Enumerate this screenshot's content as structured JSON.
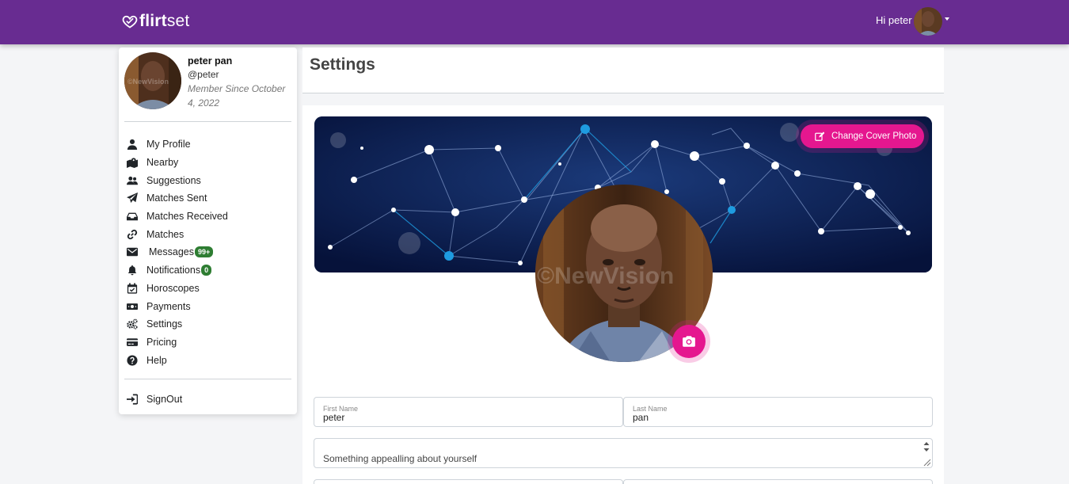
{
  "brand": {
    "name_bold": "flirt",
    "name_light": "set"
  },
  "nav": {
    "greeting": "Hi peter"
  },
  "profile": {
    "name": "peter pan",
    "handle": "@peter",
    "member_since": "Member Since October 4, 2022"
  },
  "menu": [
    {
      "label": "My Profile",
      "icon": "user-icon"
    },
    {
      "label": "Nearby",
      "icon": "map-marker-icon"
    },
    {
      "label": "Suggestions",
      "icon": "users-icon"
    },
    {
      "label": "Matches Sent",
      "icon": "paper-plane-icon"
    },
    {
      "label": "Matches Received",
      "icon": "inbox-icon"
    },
    {
      "label": "Matches",
      "icon": "link-icon"
    },
    {
      "label": "Messages",
      "icon": "envelope-icon",
      "badge": "99+"
    },
    {
      "label": "Notifications",
      "icon": "bell-icon",
      "badge": "0"
    },
    {
      "label": "Horoscopes",
      "icon": "calendar-check-icon"
    },
    {
      "label": "Payments",
      "icon": "money-bill-icon"
    },
    {
      "label": "Settings",
      "icon": "cogs-icon"
    },
    {
      "label": "Pricing",
      "icon": "credit-card-icon"
    },
    {
      "label": "Help",
      "icon": "question-circle-icon"
    }
  ],
  "signout_label": "SignOut",
  "page": {
    "title": "Settings"
  },
  "cover": {
    "button_label": "Change Cover Photo"
  },
  "photo_watermark": "©NewVision",
  "form": {
    "first_name": {
      "label": "First Name",
      "value": "peter"
    },
    "last_name": {
      "label": "Last Name",
      "value": "pan"
    },
    "bio": {
      "value": "Something appealling about yourself"
    }
  },
  "colors": {
    "nav": "#682c91",
    "accent": "#e5178f",
    "badge": "#2e7d32"
  }
}
